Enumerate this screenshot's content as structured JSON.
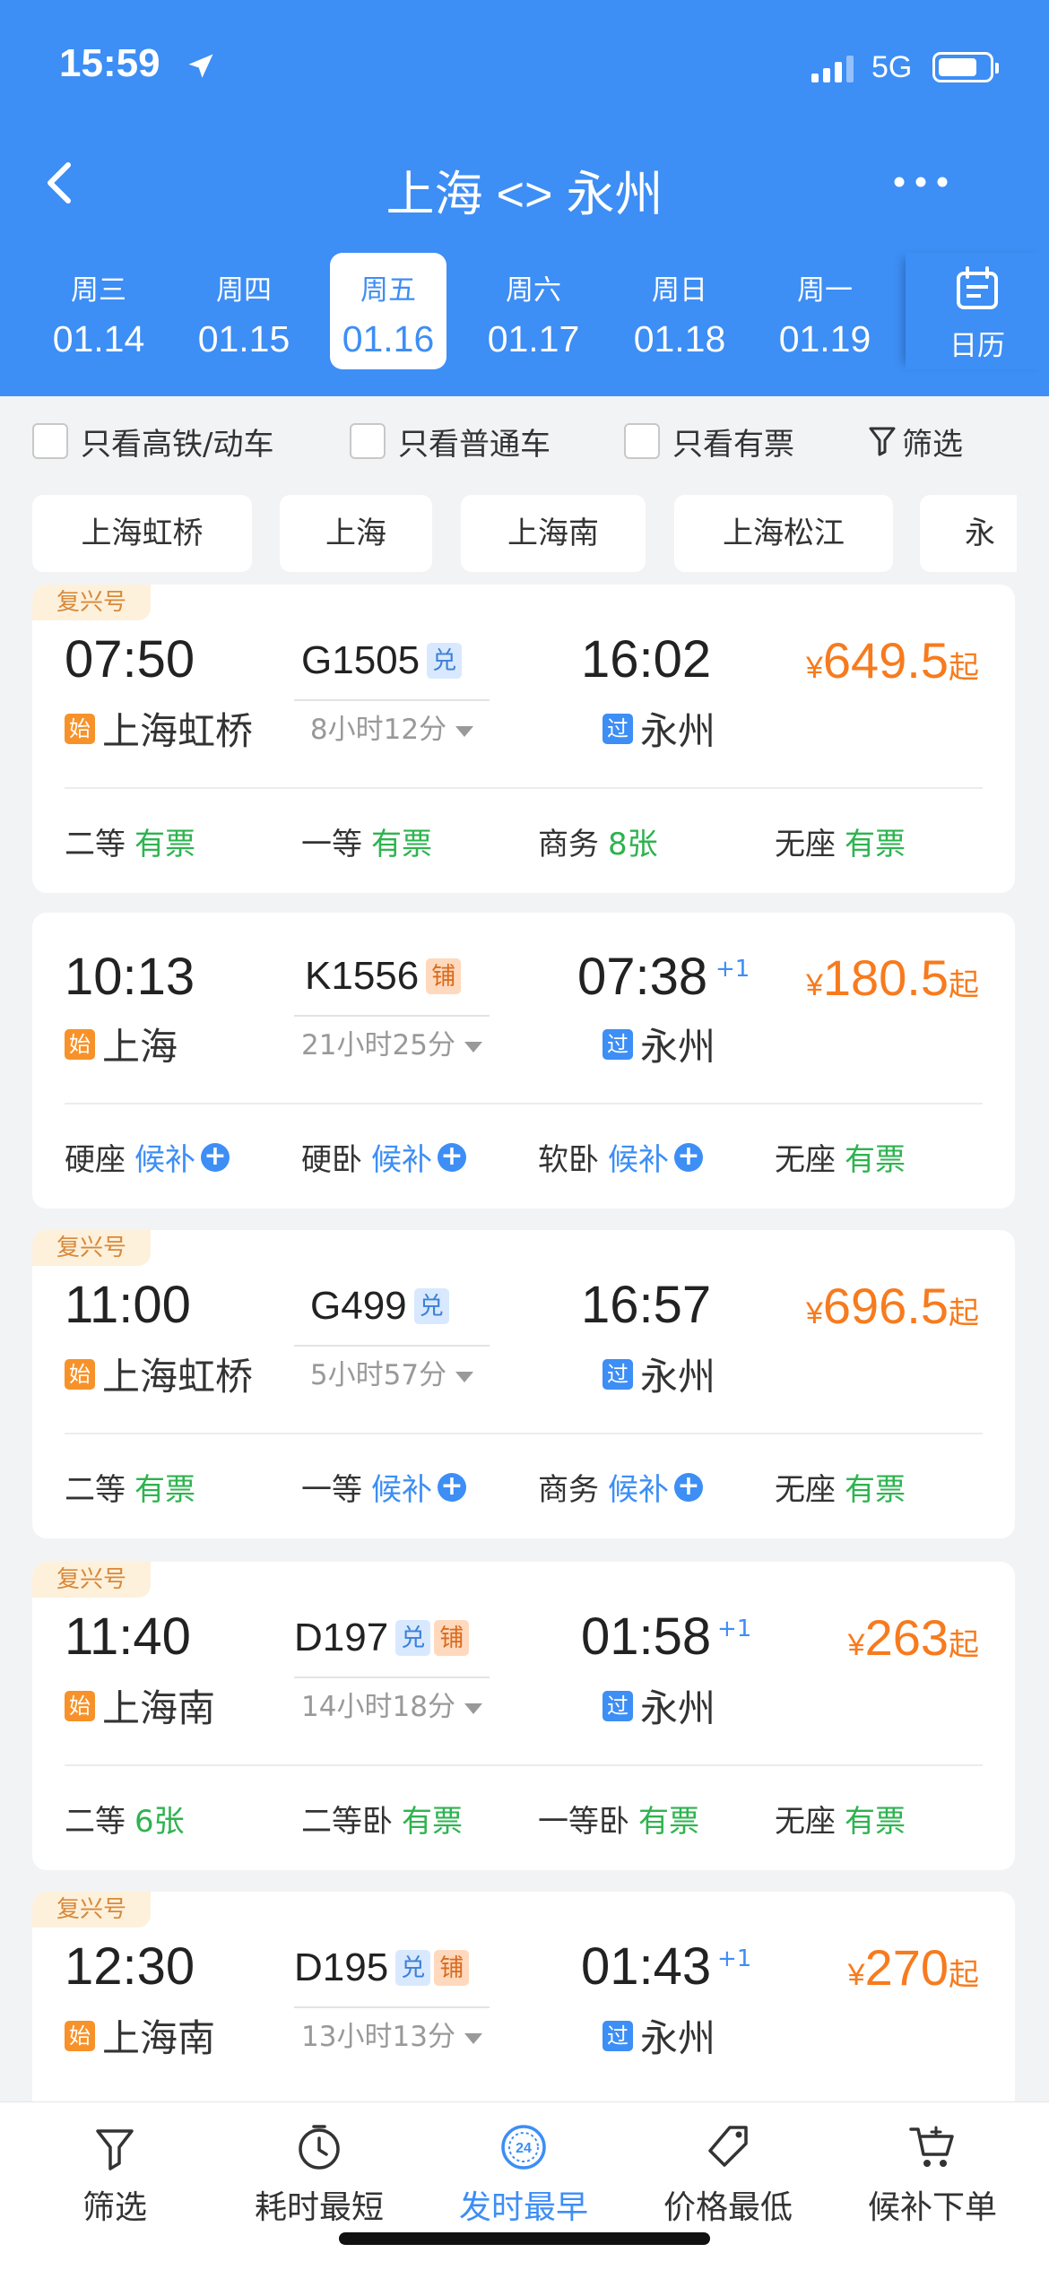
{
  "status_bar": {
    "time": "15:59",
    "network": "5G"
  },
  "header": {
    "title": "上海 <> 永州"
  },
  "dates": [
    {
      "weekday": "周三",
      "date": "01.14"
    },
    {
      "weekday": "周四",
      "date": "01.15"
    },
    {
      "weekday": "周五",
      "date": "01.16",
      "selected": true
    },
    {
      "weekday": "周六",
      "date": "01.17"
    },
    {
      "weekday": "周日",
      "date": "01.18"
    },
    {
      "weekday": "周一",
      "date": "01.19"
    }
  ],
  "calendar_label": "日历",
  "filters": {
    "high_speed": "只看高铁/动车",
    "normal": "只看普通车",
    "available": "只看有票",
    "filter": "筛选"
  },
  "stations": [
    "上海虹桥",
    "上海",
    "上海南",
    "上海松江",
    "永州"
  ],
  "colors": {
    "primary": "#3d8ef5",
    "price": "#f77b1e",
    "available": "#2eb34f"
  },
  "trains": [
    {
      "badge": "复兴号",
      "depart_time": "07:50",
      "train_no": "G1505",
      "tags": [
        "兑"
      ],
      "duration": "8小时12分",
      "arrive_time": "16:02",
      "day_offset": "",
      "from_station": "上海虹桥",
      "from_icon": "始",
      "to_station": "永州",
      "to_icon": "过",
      "price_currency": "¥",
      "price": "649.5",
      "price_suffix": "起",
      "seats": [
        {
          "name": "二等",
          "status": "有票"
        },
        {
          "name": "一等",
          "status": "有票"
        },
        {
          "name": "商务",
          "status": "8张"
        },
        {
          "name": "无座",
          "status": "有票"
        }
      ]
    },
    {
      "badge": "",
      "depart_time": "10:13",
      "train_no": "K1556",
      "tags": [
        "铺"
      ],
      "duration": "21小时25分",
      "arrive_time": "07:38",
      "day_offset": "+1",
      "from_station": "上海",
      "from_icon": "始",
      "to_station": "永州",
      "to_icon": "过",
      "price_currency": "¥",
      "price": "180.5",
      "price_suffix": "起",
      "seats": [
        {
          "name": "硬座",
          "status": "候补"
        },
        {
          "name": "硬卧",
          "status": "候补"
        },
        {
          "name": "软卧",
          "status": "候补"
        },
        {
          "name": "无座",
          "status": "有票"
        }
      ]
    },
    {
      "badge": "复兴号",
      "depart_time": "11:00",
      "train_no": "G499",
      "tags": [
        "兑"
      ],
      "duration": "5小时57分",
      "arrive_time": "16:57",
      "day_offset": "",
      "from_station": "上海虹桥",
      "from_icon": "始",
      "to_station": "永州",
      "to_icon": "过",
      "price_currency": "¥",
      "price": "696.5",
      "price_suffix": "起",
      "seats": [
        {
          "name": "二等",
          "status": "有票"
        },
        {
          "name": "一等",
          "status": "候补"
        },
        {
          "name": "商务",
          "status": "候补"
        },
        {
          "name": "无座",
          "status": "有票"
        }
      ]
    },
    {
      "badge": "复兴号",
      "depart_time": "11:40",
      "train_no": "D197",
      "tags": [
        "兑",
        "铺"
      ],
      "duration": "14小时18分",
      "arrive_time": "01:58",
      "day_offset": "+1",
      "from_station": "上海南",
      "from_icon": "始",
      "to_station": "永州",
      "to_icon": "过",
      "price_currency": "¥",
      "price": "263",
      "price_suffix": "起",
      "seats": [
        {
          "name": "二等",
          "status": "6张"
        },
        {
          "name": "二等卧",
          "status": "有票"
        },
        {
          "name": "一等卧",
          "status": "有票"
        },
        {
          "name": "无座",
          "status": "有票"
        }
      ]
    },
    {
      "badge": "复兴号",
      "depart_time": "12:30",
      "train_no": "D195",
      "tags": [
        "兑",
        "铺"
      ],
      "duration": "13小时13分",
      "arrive_time": "01:43",
      "day_offset": "+1",
      "from_station": "上海南",
      "from_icon": "始",
      "to_station": "永州",
      "to_icon": "过",
      "price_currency": "¥",
      "price": "270",
      "price_suffix": "起",
      "seats": []
    }
  ],
  "bottom_tabs": [
    {
      "label": "筛选",
      "icon": "filter-icon"
    },
    {
      "label": "耗时最短",
      "icon": "timer-icon"
    },
    {
      "label": "发时最早",
      "icon": "clock-24-icon",
      "icon_text": "24",
      "active": true
    },
    {
      "label": "价格最低",
      "icon": "price-tag-icon"
    },
    {
      "label": "候补下单",
      "icon": "cart-icon"
    }
  ]
}
